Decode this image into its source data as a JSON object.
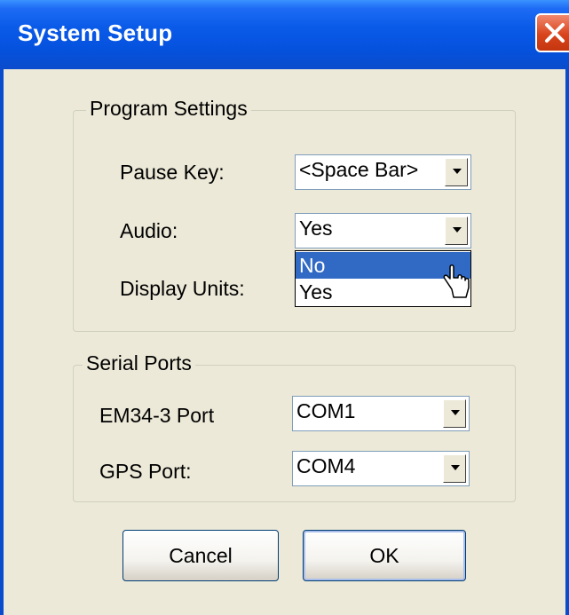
{
  "window": {
    "title": "System Setup"
  },
  "program_settings": {
    "title": "Program Settings",
    "pause_key": {
      "label": "Pause Key:",
      "value": "<Space Bar>"
    },
    "audio": {
      "label": "Audio:",
      "value": "Yes",
      "options": [
        "No",
        "Yes"
      ],
      "highlighted": "No"
    },
    "display_units": {
      "label": "Display Units:"
    }
  },
  "serial_ports": {
    "title": "Serial Ports",
    "em34_port": {
      "label": "EM34-3 Port",
      "value": "COM1"
    },
    "gps_port": {
      "label": "GPS Port:",
      "value": "COM4"
    }
  },
  "buttons": {
    "cancel": "Cancel",
    "ok": "OK"
  }
}
